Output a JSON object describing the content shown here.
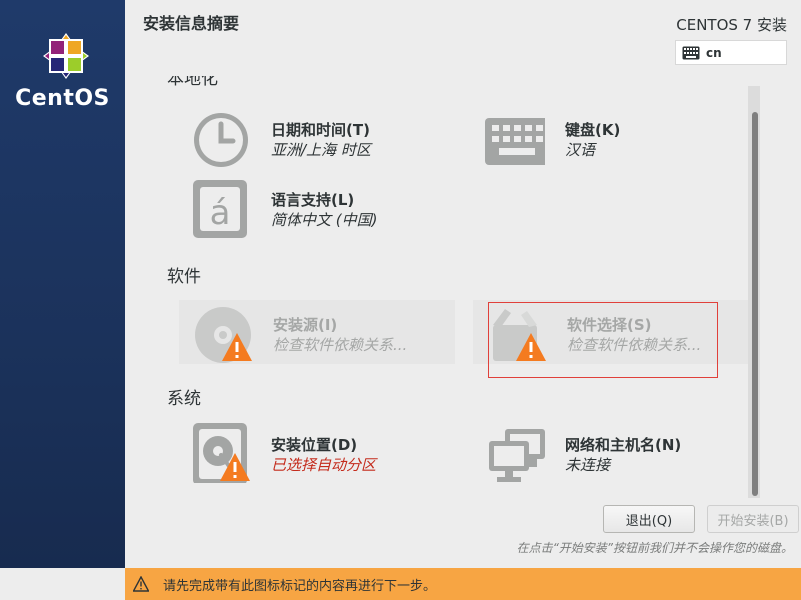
{
  "brand": {
    "name": "CentOS",
    "logo_icon": "centos-logo"
  },
  "header": {
    "title": "安装信息摘要",
    "product": "CENTOS 7 安装",
    "keyboard_layout": "cn"
  },
  "sections": {
    "localization": {
      "heading": "本地化"
    },
    "software": {
      "heading": "软件"
    },
    "system": {
      "heading": "系统"
    }
  },
  "spokes": {
    "datetime": {
      "title": "日期和时间(T)",
      "status": "亚洲/上海 时区",
      "icon": "clock-icon"
    },
    "keyboard": {
      "title": "键盘(K)",
      "status": "汉语",
      "icon": "keyboard-icon"
    },
    "language": {
      "title": "语言支持(L)",
      "status": "简体中文 (中国)",
      "icon": "language-icon"
    },
    "install_source": {
      "title": "安装源(I)",
      "status": "检查软件依赖关系...",
      "icon": "disc-icon",
      "warning": true,
      "enabled": false
    },
    "software_selection": {
      "title": "软件选择(S)",
      "status": "检查软件依赖关系...",
      "icon": "package-icon",
      "warning": true,
      "enabled": false
    },
    "install_destination": {
      "title": "安装位置(D)",
      "status": "已选择自动分区",
      "icon": "harddisk-icon",
      "warning": true
    },
    "network": {
      "title": "网络和主机名(N)",
      "status": "未连接",
      "icon": "network-icon"
    }
  },
  "buttons": {
    "quit": "退出(Q)",
    "begin": "开始安装(B)"
  },
  "footer_note": "在点击“开始安装”按钮前我们并不会操作您的磁盘。",
  "warning_bar": {
    "text": "请先完成带有此图标标记的内容再进行下一步。",
    "icon": "warning-icon"
  },
  "colors": {
    "sidebar": "#1f3a6a",
    "warning_bar": "#f7a543",
    "warning_icon": "#f47b20",
    "error_text": "#c42b1c",
    "highlight": "#e0403a"
  }
}
